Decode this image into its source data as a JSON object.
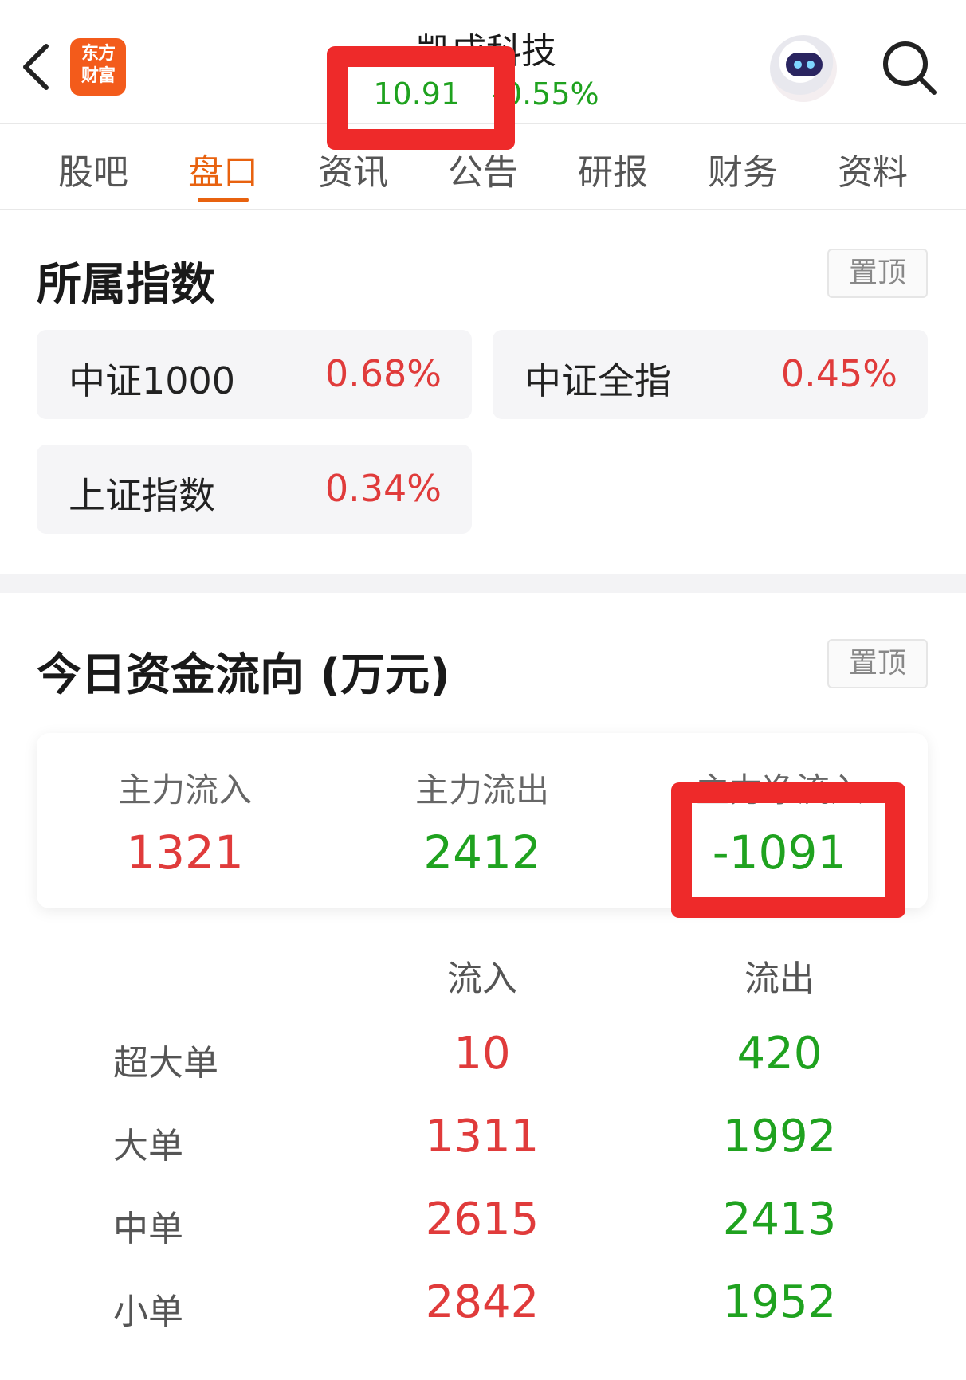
{
  "header": {
    "logo_line1": "东方",
    "logo_line2": "财富",
    "stock_name": "凯成科技",
    "price": "10.91",
    "change_pct": "-0.55%",
    "icons": [
      "back-arrow-icon",
      "robot-avatar-icon",
      "search-icon"
    ]
  },
  "tabs": [
    {
      "label": "股吧",
      "active": false
    },
    {
      "label": "盘口",
      "active": true
    },
    {
      "label": "资讯",
      "active": false
    },
    {
      "label": "公告",
      "active": false
    },
    {
      "label": "研报",
      "active": false
    },
    {
      "label": "财务",
      "active": false
    },
    {
      "label": "资料",
      "active": false
    }
  ],
  "indices": {
    "title": "所属指数",
    "pin_label": "置顶",
    "items": [
      {
        "name": "中证1000",
        "value": "0.68%"
      },
      {
        "name": "中证全指",
        "value": "0.45%"
      },
      {
        "name": "上证指数",
        "value": "0.34%"
      }
    ]
  },
  "fund_flow": {
    "title": "今日资金流向 (万元)",
    "pin_label": "置顶",
    "summary": [
      {
        "label": "主力流入",
        "value": "1321"
      },
      {
        "label": "主力流出",
        "value": "2412"
      },
      {
        "label": "主力净流入",
        "value": "-1091"
      }
    ],
    "columns": [
      "流入",
      "流出"
    ],
    "rows": [
      {
        "label": "超大单",
        "inflow": "10",
        "outflow": "420"
      },
      {
        "label": "大单",
        "inflow": "1311",
        "outflow": "1992"
      },
      {
        "label": "中单",
        "inflow": "2615",
        "outflow": "2413"
      },
      {
        "label": "小单",
        "inflow": "2842",
        "outflow": "1952"
      }
    ]
  },
  "colors": {
    "accent": "#e8620f",
    "up": "#e03b3b",
    "down": "#1fa21f",
    "highlight": "#ee2a2a"
  }
}
